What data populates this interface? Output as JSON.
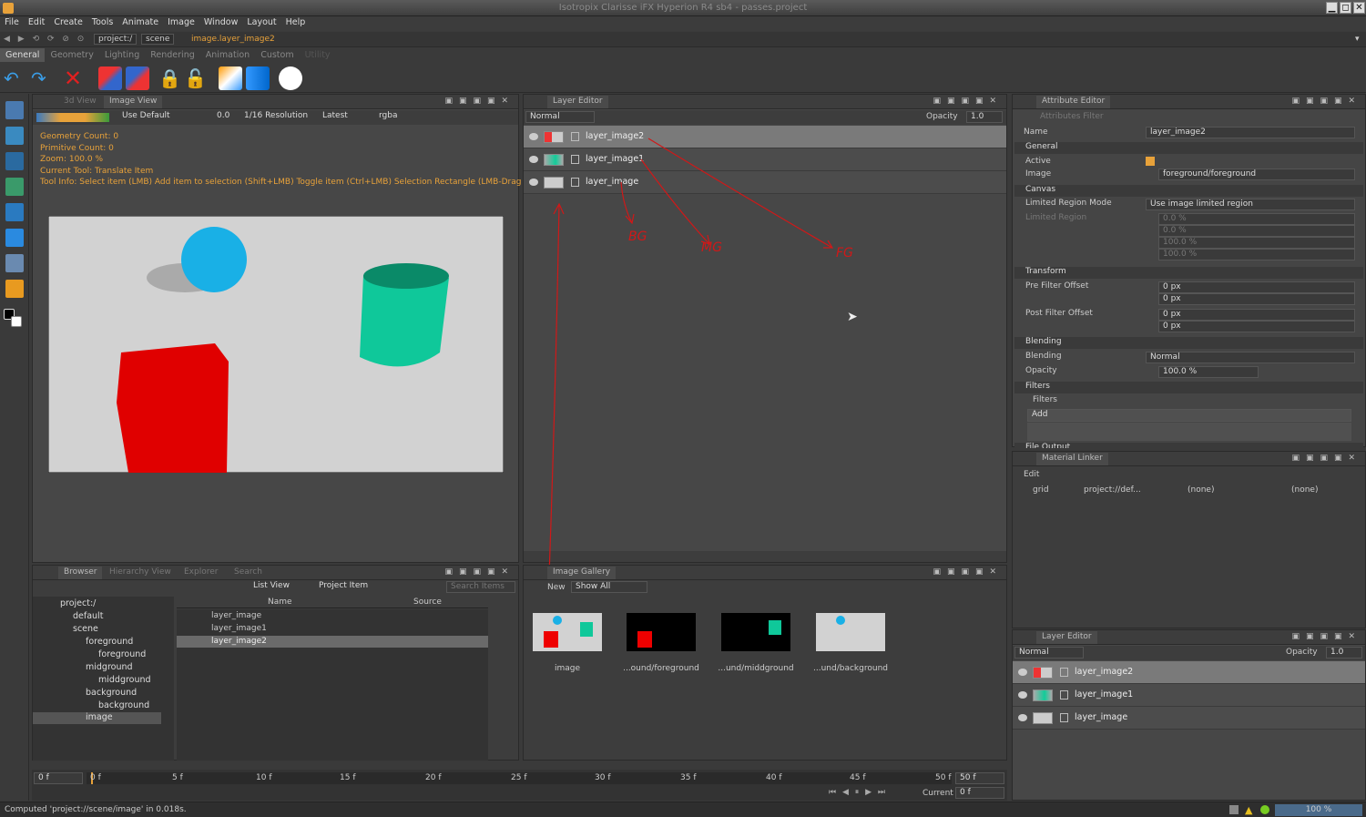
{
  "window": {
    "title": "Isotropix Clarisse iFX Hyperion R4 sb4 - passes.project",
    "min": "▁",
    "max": "◻",
    "close": "✕"
  },
  "menu": [
    "File",
    "Edit",
    "Create",
    "Tools",
    "Animate",
    "Image",
    "Window",
    "Layout",
    "Help"
  ],
  "path": {
    "root": "project:/",
    "scene": "scene",
    "item": "image.layer_image2"
  },
  "shelf_tabs": [
    "General",
    "Geometry",
    "Lighting",
    "Rendering",
    "Animation",
    "Custom",
    "Utility"
  ],
  "viewport": {
    "tabs": [
      "3d View",
      "Image View"
    ],
    "display": "Use Default",
    "exposure": "0.0",
    "resolution": "1/16 Resolution",
    "frame": "Latest",
    "channel": "rgba",
    "hud": [
      "Geometry Count: 0",
      "Primitive Count: 0",
      "Zoom: 100.0 %",
      "Current Tool: Translate Item",
      "Tool Info: Select item (LMB)  Add item to selection (Shift+LMB)  Toggle item (Ctrl+LMB)  Selection Rectangle (LMB-Drag"
    ]
  },
  "layer_editor": {
    "title": "Layer Editor",
    "blend": "Normal",
    "opacity_label": "Opacity",
    "opacity": "1.0",
    "layers": [
      "layer_image2",
      "layer_image1",
      "layer_image"
    ],
    "annotations": [
      "BG",
      "MG",
      "FG"
    ]
  },
  "attr": {
    "title": "Attribute Editor",
    "filter_ph": "Attributes Filter",
    "name_label": "Name",
    "name": "layer_image2",
    "general": "General",
    "active": "Active",
    "image_label": "Image",
    "image": "foreground/foreground",
    "canvas": "Canvas",
    "lrm_label": "Limited Region Mode",
    "lrm": "Use image limited region",
    "lr_label": "Limited Region",
    "lr": [
      "0.0 %",
      "0.0 %",
      "100.0 %",
      "100.0 %"
    ],
    "transform": "Transform",
    "pre_label": "Pre Filter Offset",
    "pre": [
      "0 px",
      "0 px"
    ],
    "post_label": "Post Filter Offset",
    "post": [
      "0 px",
      "0 px"
    ],
    "blending": "Blending",
    "blend_label": "Blending",
    "blend": "Normal",
    "opacity_label": "Opacity",
    "opacity": "100.0 %",
    "filters": "Filters",
    "filters_sub": "Filters",
    "add": "Add",
    "file_output": "File Output"
  },
  "material": {
    "title": "Material Linker",
    "edit": "Edit",
    "obj": "grid",
    "mat": "project://def...",
    "a": "(none)",
    "b": "(none)"
  },
  "layer2": {
    "title": "Layer Editor",
    "blend": "Normal",
    "opacity_label": "Opacity",
    "opacity": "1.0",
    "layers": [
      "layer_image2",
      "layer_image1",
      "layer_image"
    ]
  },
  "browser": {
    "tabs": [
      "Browser",
      "Hierarchy View",
      "Explorer",
      "Search"
    ],
    "view": "List View",
    "kind": "Project Item",
    "search_ph": "Search Items",
    "tree": [
      "project:/",
      "default",
      "scene",
      "foreground",
      "foreground",
      "midground",
      "middground",
      "background",
      "background",
      "image"
    ],
    "cols": [
      "Name",
      "Source"
    ],
    "items": [
      "layer_image",
      "layer_image1",
      "layer_image2"
    ]
  },
  "gallery": {
    "title": "Image Gallery",
    "new": "New",
    "show": "Show All",
    "thumbs": [
      "image",
      "...ound/foreground",
      "...und/middground",
      "...und/background"
    ]
  },
  "timeline": {
    "start": "0 f",
    "end": "50 f",
    "ticks": [
      "0 f",
      "5 f",
      "10 f",
      "15 f",
      "20 f",
      "25 f",
      "30 f",
      "35 f",
      "40 f",
      "45 f",
      "50 f"
    ],
    "current_label": "Current",
    "current": "0 f"
  },
  "status": {
    "text": "Computed 'project://scene/image' in 0.018s.",
    "zoom": "100 %"
  }
}
